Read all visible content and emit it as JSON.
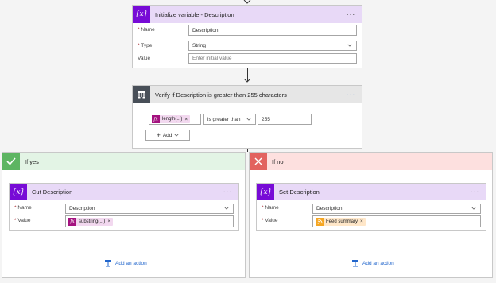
{
  "init_variable": {
    "title": "Initialize variable - Description",
    "icon": "variable-icon",
    "name_label": "Name",
    "name_value": "Description",
    "type_label": "Type",
    "type_value": "String",
    "value_label": "Value",
    "value_placeholder": "Enter initial value"
  },
  "condition": {
    "title": "Verify if Description is greater than 255 characters",
    "icon": "condition-icon",
    "token_label": "length(...)",
    "operator": "is greater than",
    "compare_value": "255",
    "add_label": "Add"
  },
  "if_yes": {
    "label": "If yes",
    "action": {
      "title": "Cut Description",
      "name_label": "Name",
      "name_value": "Description",
      "value_label": "Value",
      "token_label": "substring(...)"
    },
    "add_action_label": "Add an action"
  },
  "if_no": {
    "label": "If no",
    "action": {
      "title": "Set Description",
      "name_label": "Name",
      "name_value": "Description",
      "value_label": "Value",
      "token_label": "Feed summary"
    },
    "add_action_label": "Add an action"
  },
  "colors": {
    "variable_purple": "#770bd6",
    "variable_header": "#e8d9f7",
    "condition_dark": "#484f58",
    "condition_header": "#e6e6e6",
    "yes_green": "#5db562",
    "no_red": "#e2625f",
    "link_blue": "#2266cc"
  }
}
